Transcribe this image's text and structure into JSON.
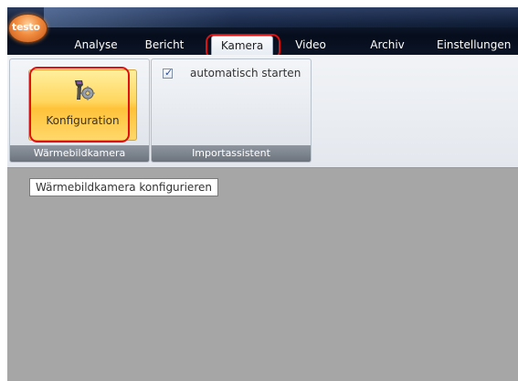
{
  "app": {
    "logo_text": "testo"
  },
  "tabs": [
    {
      "label": "Analyse"
    },
    {
      "label": "Bericht"
    },
    {
      "label": "Kamera"
    },
    {
      "label": "Video"
    },
    {
      "label": "Archiv"
    },
    {
      "label": "Einstellungen"
    }
  ],
  "active_tab": "Kamera",
  "ribbon": {
    "groups": [
      {
        "label": "Wärmebildkamera",
        "button_label": "Konfiguration",
        "button_icon": "thermal-camera-settings-icon"
      },
      {
        "label": "Importassistent",
        "checkbox_label": "automatisch starten",
        "checkbox_checked": true
      }
    ]
  },
  "tooltip": {
    "text": "Wärmebildkamera konfigurieren"
  },
  "colors": {
    "highlight": "#e01010",
    "active_button": "#ffd65e",
    "workspace": "#a6a6a6"
  }
}
